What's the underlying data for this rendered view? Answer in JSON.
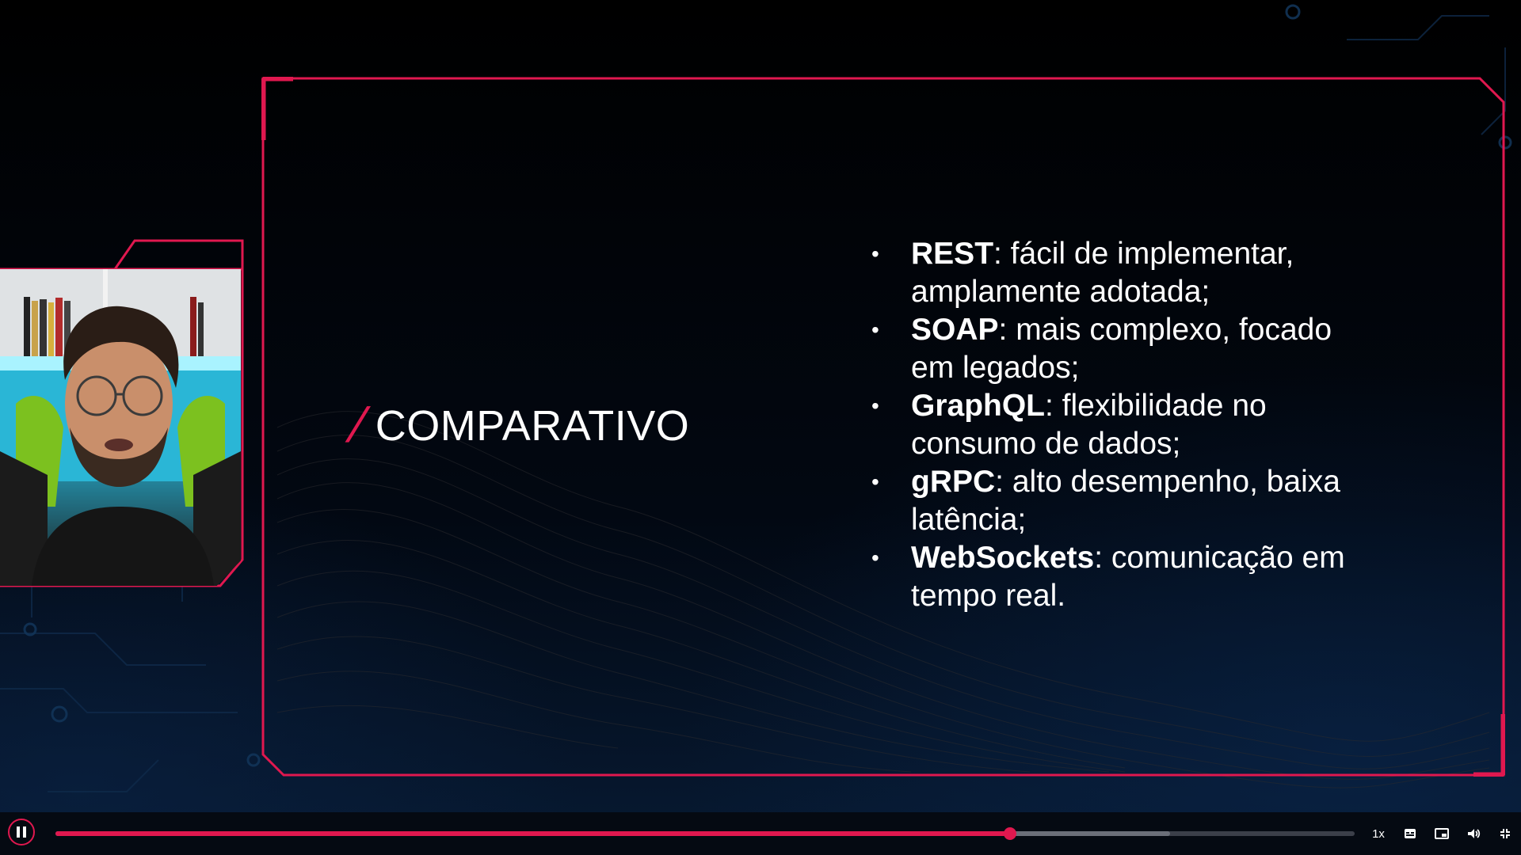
{
  "slide": {
    "title_slash": "/",
    "title": "COMPARATIVO",
    "bullets": [
      {
        "term": "REST",
        "rest": ": fácil de implementar,",
        "rest2": "amplamente adotada;"
      },
      {
        "term": "SOAP",
        "rest": ": mais complexo, focado",
        "rest2": "em legados;"
      },
      {
        "term": "GraphQL",
        "rest": ": flexibilidade no",
        "rest2": "consumo de dados;"
      },
      {
        "term": "gRPC",
        "rest": ": alto desempenho, baixa",
        "rest2": "latência;"
      },
      {
        "term": "WebSockets",
        "rest": ": comunicação em",
        "rest2": "tempo real."
      }
    ],
    "bullet_symbol": "•"
  },
  "player": {
    "speed_label": "1x",
    "progress_fraction": 0.735,
    "buffered_fraction": 0.858,
    "icons": {
      "pause": "pause-icon",
      "captions": "captions-icon",
      "pip": "picture-in-picture-icon",
      "volume": "volume-icon",
      "fullscreen": "exit-fullscreen-icon"
    }
  },
  "colors": {
    "accent": "#e0184f",
    "background": "#000000",
    "text": "#ffffff"
  }
}
